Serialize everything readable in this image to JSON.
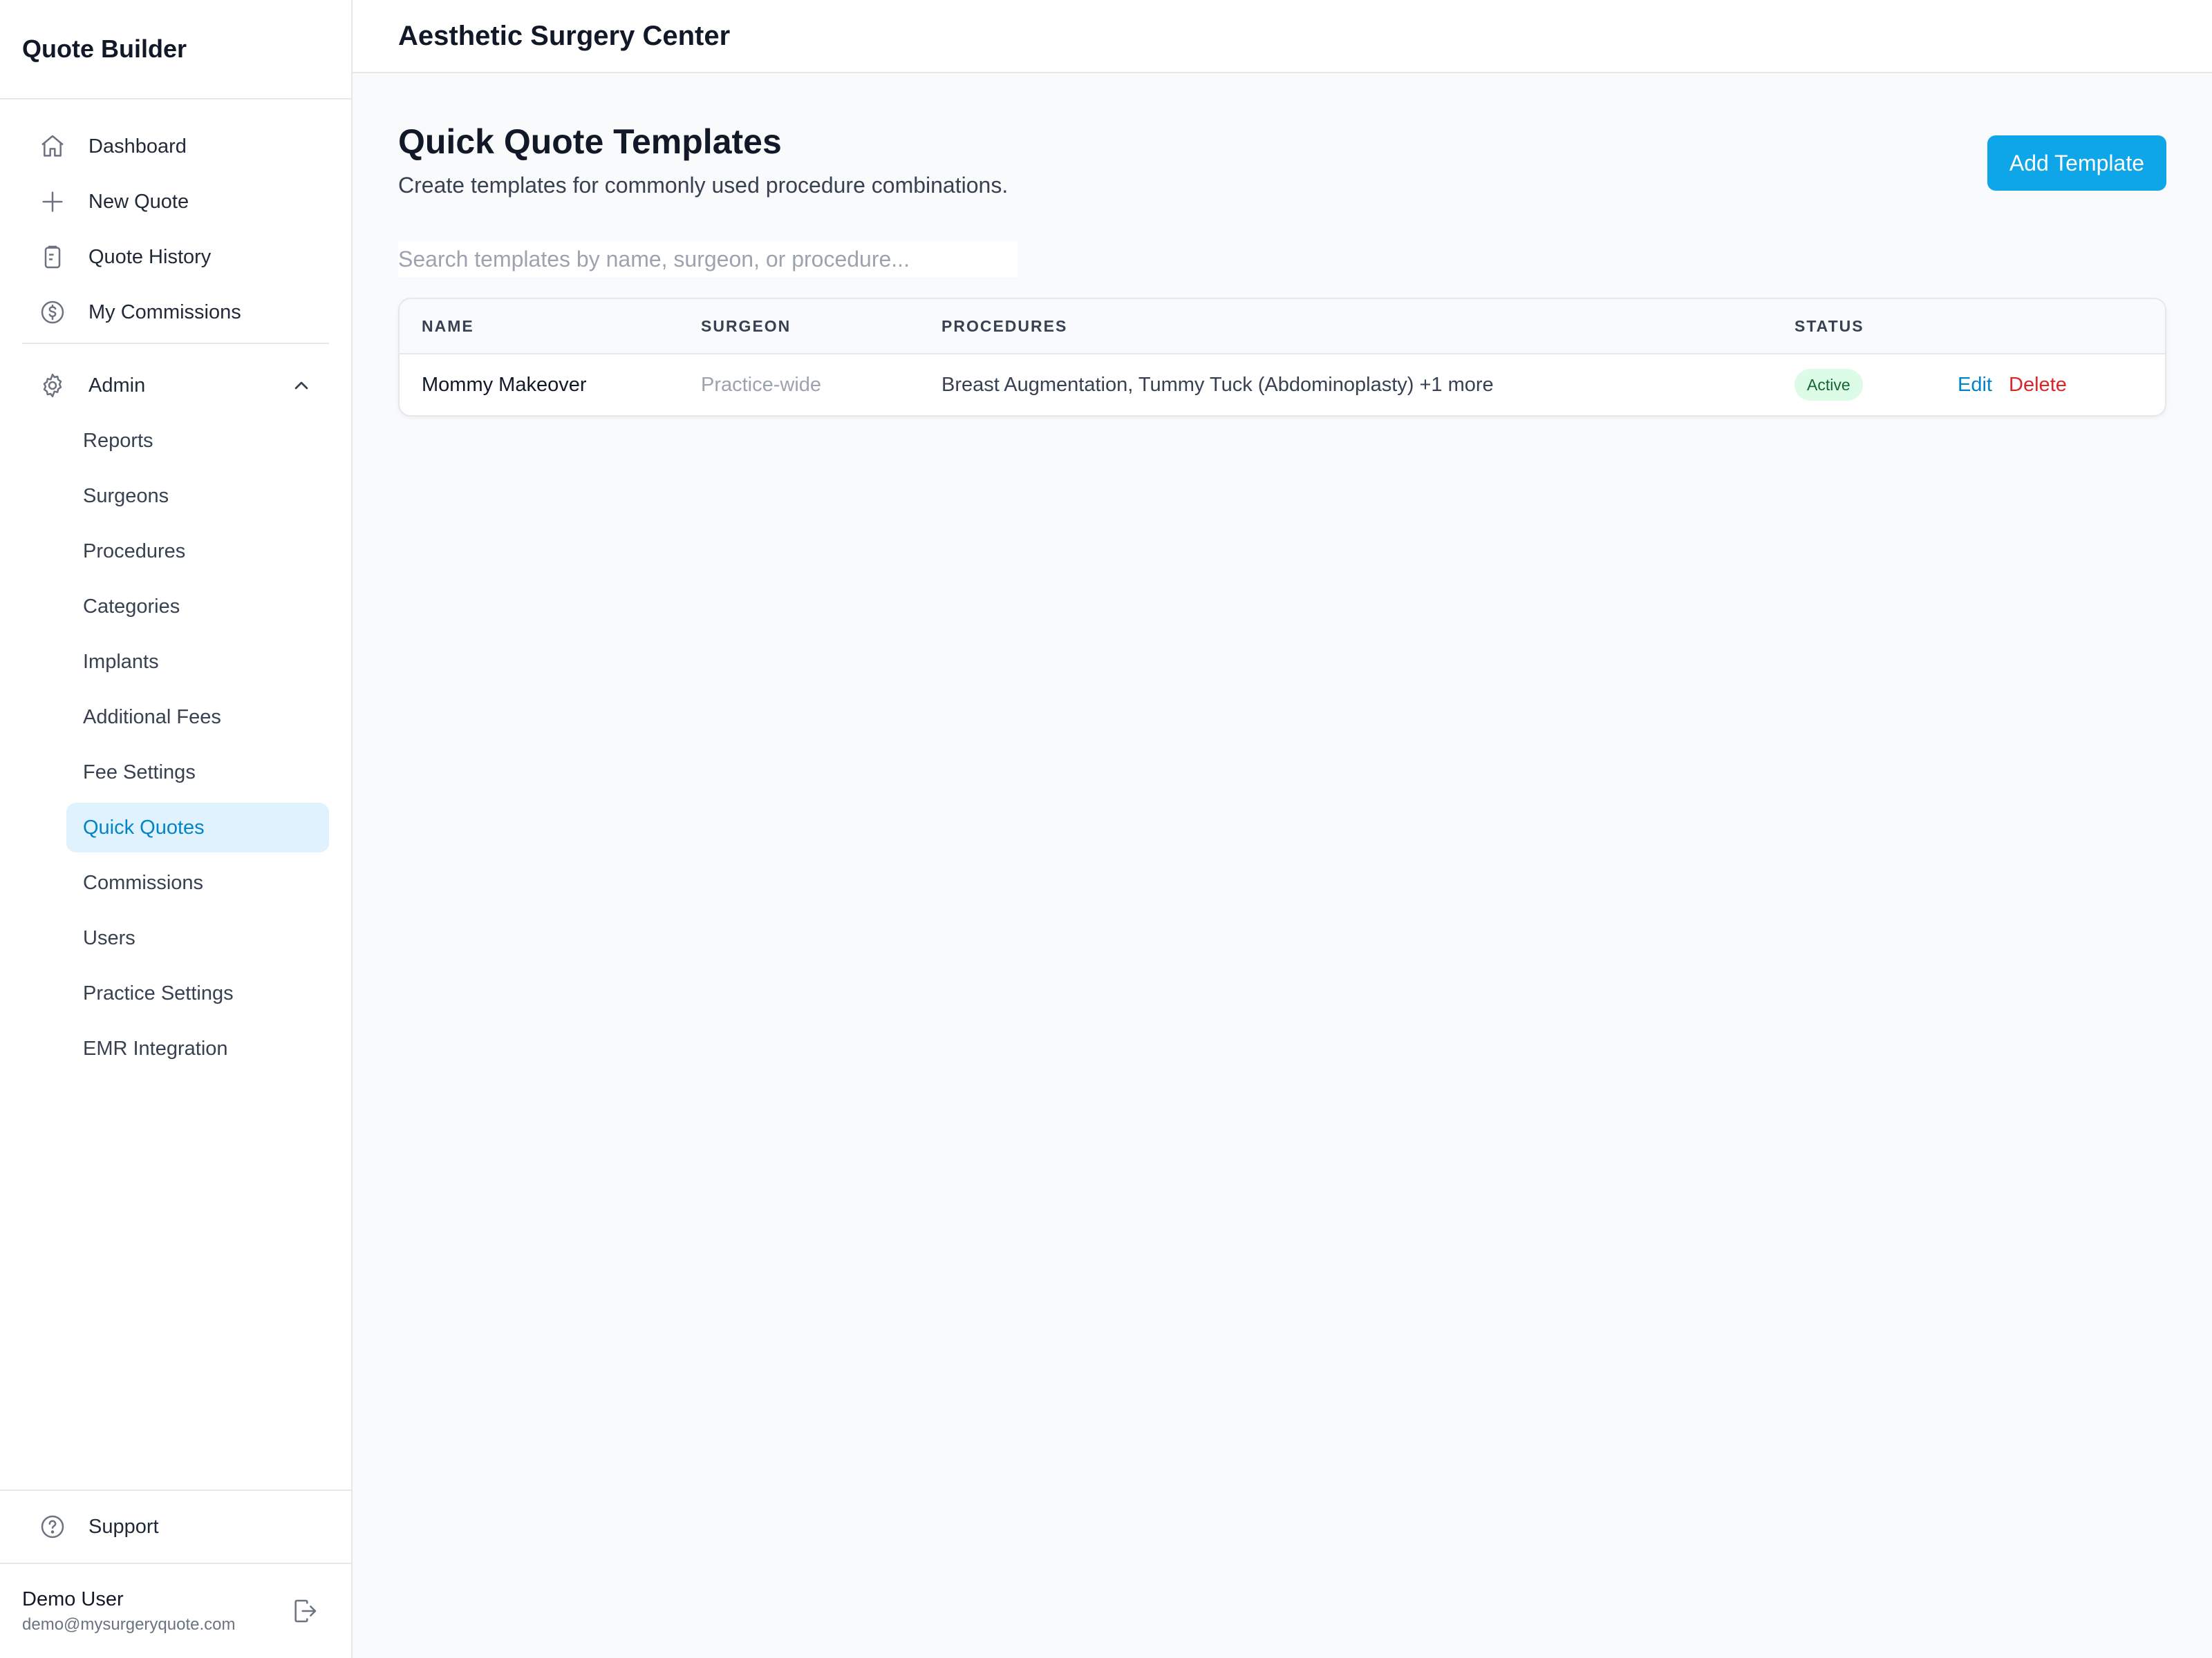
{
  "app": {
    "brand": "Quote Builder",
    "practice": "Aesthetic Surgery Center"
  },
  "nav": {
    "main": [
      {
        "label": "Dashboard",
        "icon": "home-icon"
      },
      {
        "label": "New Quote",
        "icon": "plus-icon"
      },
      {
        "label": "Quote History",
        "icon": "clipboard-icon"
      },
      {
        "label": "My Commissions",
        "icon": "dollar-icon"
      }
    ],
    "admin": {
      "label": "Admin",
      "icon": "gear-icon",
      "expanded": true,
      "items": [
        "Reports",
        "Surgeons",
        "Procedures",
        "Categories",
        "Implants",
        "Additional Fees",
        "Fee Settings",
        "Quick Quotes",
        "Commissions",
        "Users",
        "Practice Settings",
        "EMR Integration"
      ],
      "active": "Quick Quotes"
    },
    "support": "Support"
  },
  "user": {
    "name": "Demo User",
    "email": "demo@mysurgeryquote.com"
  },
  "page": {
    "title": "Quick Quote Templates",
    "subtitle": "Create templates for commonly used procedure combinations.",
    "add_button": "Add Template",
    "search_placeholder": "Search templates by name, surgeon, or procedure..."
  },
  "table": {
    "headers": {
      "name": "NAME",
      "surgeon": "SURGEON",
      "procedures": "PROCEDURES",
      "status": "STATUS"
    },
    "rows": [
      {
        "name": "Mommy Makeover",
        "surgeon": "Practice-wide",
        "procedures": "Breast Augmentation, Tummy Tuck (Abdominoplasty) +1 more",
        "status": "Active",
        "edit": "Edit",
        "delete": "Delete"
      }
    ]
  },
  "colors": {
    "accent": "#0ea5e9",
    "active_bg": "#e0f2fe",
    "active_text": "#0284c7",
    "danger": "#dc2626",
    "success_bg": "#dcfce7",
    "success_text": "#166534"
  }
}
